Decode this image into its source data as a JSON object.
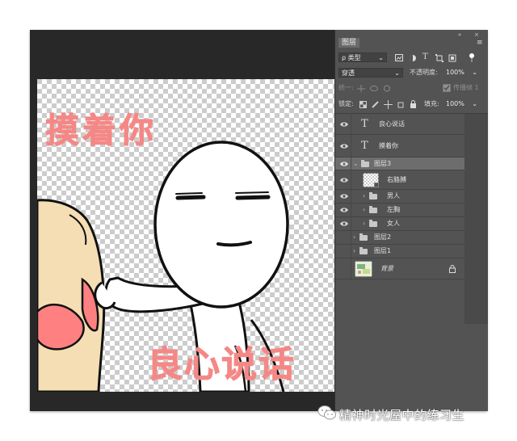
{
  "canvas": {
    "text_top": "摸着你",
    "text_bottom": "良心说话"
  },
  "layers_panel": {
    "tab_label": "图层",
    "filter": {
      "kind_label": "ρ 类型"
    },
    "blend_mode": "穿透",
    "opacity_label": "不透明度:",
    "opacity_value": "100%",
    "unify_label": "统一:",
    "propagate_label": "传播帧 1",
    "lock_label": "锁定:",
    "fill_label": "填充:",
    "fill_value": "100%",
    "layers": [
      {
        "name": "良心说话",
        "type": "text",
        "visible": true
      },
      {
        "name": "摸着你",
        "type": "text",
        "visible": true
      },
      {
        "name": "图层3",
        "type": "group",
        "visible": true,
        "expanded": true,
        "selected": true
      },
      {
        "name": "右胳膊",
        "type": "pixel",
        "visible": true
      },
      {
        "name": "男人",
        "type": "group",
        "visible": true
      },
      {
        "name": "左胸",
        "type": "group",
        "visible": true
      },
      {
        "name": "女人",
        "type": "group",
        "visible": true
      },
      {
        "name": "图层2",
        "type": "group",
        "visible": false
      },
      {
        "name": "图层1",
        "type": "group",
        "visible": false
      },
      {
        "name": "背景",
        "type": "background",
        "visible": false,
        "locked": true
      }
    ]
  },
  "watermark": {
    "text": "精神时光屋中的练习生",
    "icon": "wechat-icon"
  }
}
